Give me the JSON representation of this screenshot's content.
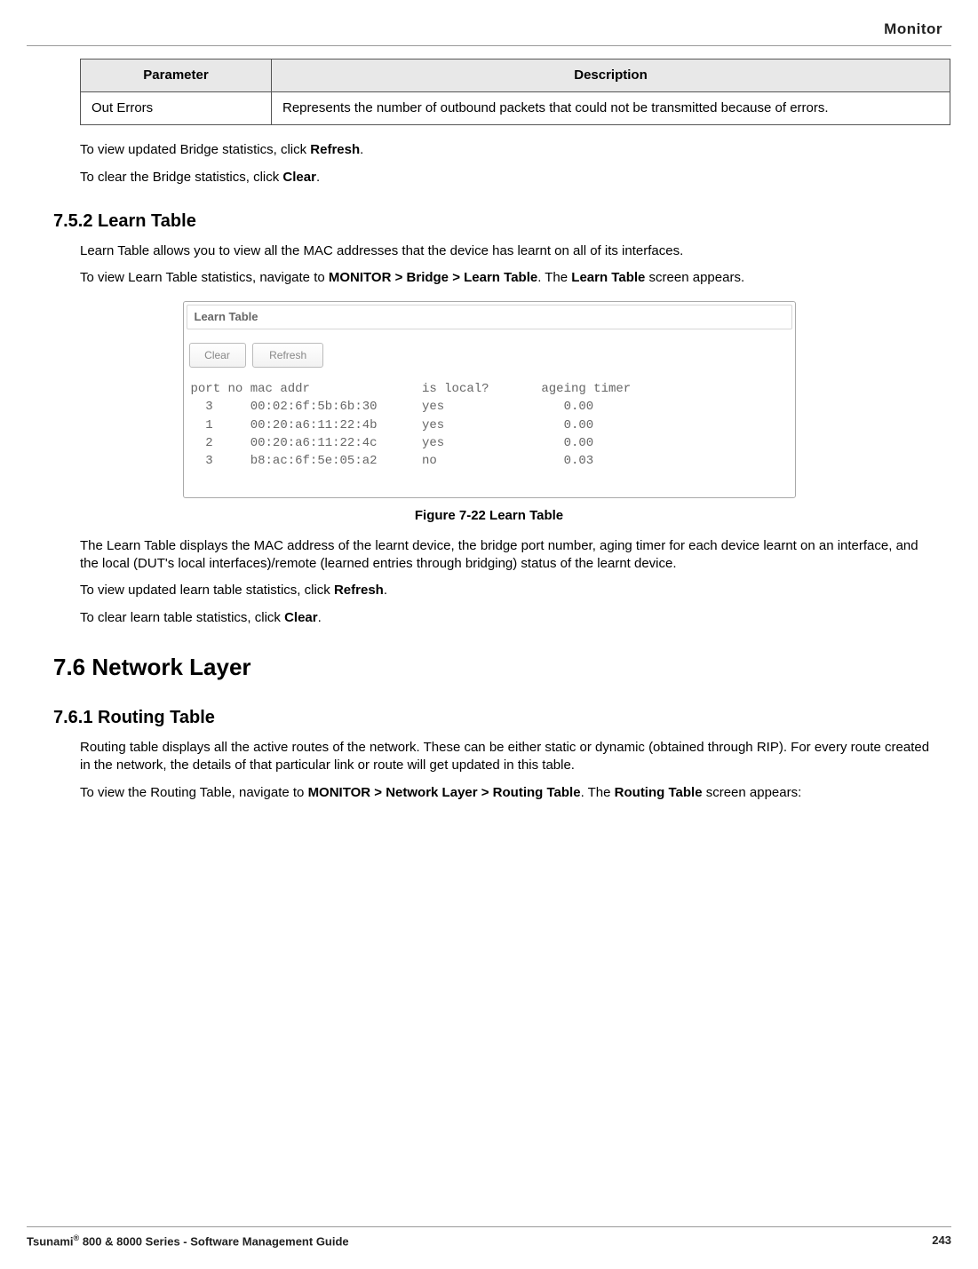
{
  "header": {
    "section": "Monitor"
  },
  "param_table": {
    "col_parameter": "Parameter",
    "col_description": "Description",
    "rows": [
      {
        "param": "Out Errors",
        "desc": "Represents the number of outbound packets that could not be transmitted because of errors."
      }
    ]
  },
  "p1_a": "To view updated Bridge statistics, click ",
  "p1_b": "Refresh",
  "p1_c": ".",
  "p2_a": "To clear the Bridge statistics, click ",
  "p2_b": "Clear",
  "p2_c": ".",
  "sec_752": "7.5.2 Learn Table",
  "p3": "Learn Table allows you to view all the MAC addresses that the device has learnt on all of its interfaces.",
  "p4_a": "To view Learn Table statistics, navigate to ",
  "p4_b": "MONITOR > Bridge > Learn Table",
  "p4_c": ". The ",
  "p4_d": "Learn Table",
  "p4_e": " screen appears.",
  "learn_panel": {
    "title": "Learn Table",
    "btn_clear": "Clear",
    "btn_refresh": "Refresh",
    "header_line": "port no mac addr               is local?       ageing timer",
    "rows": [
      "  3     00:02:6f:5b:6b:30      yes                0.00",
      "  1     00:20:a6:11:22:4b      yes                0.00",
      "  2     00:20:a6:11:22:4c      yes                0.00",
      "  3     b8:ac:6f:5e:05:a2      no                 0.03"
    ]
  },
  "figure_caption": "Figure 7-22  Learn Table",
  "p5": "The Learn Table displays the MAC address of the learnt device, the bridge port number, aging timer for each device learnt on an interface, and the local (DUT's local interfaces)/remote (learned entries through bridging) status of the learnt device.",
  "p6_a": "To view updated learn table statistics, click ",
  "p6_b": "Refresh",
  "p6_c": ".",
  "p7_a": "To clear learn table statistics, click ",
  "p7_b": "Clear",
  "p7_c": ".",
  "sec_76": "7.6 Network Layer",
  "sec_761": "7.6.1 Routing Table",
  "p8": "Routing table displays all the active routes of the network. These can be either static or dynamic (obtained through RIP). For every route created in the network, the details of that particular link or route will get updated in this table.",
  "p9_a": "To view the Routing Table, navigate to ",
  "p9_b": "MONITOR > Network Layer > Routing Table",
  "p9_c": ". The ",
  "p9_d": "Routing Table",
  "p9_e": " screen appears:",
  "footer": {
    "left_a": "Tsunami",
    "left_b": "®",
    "left_c": " 800 & 8000 Series - Software Management Guide",
    "page": "243"
  }
}
